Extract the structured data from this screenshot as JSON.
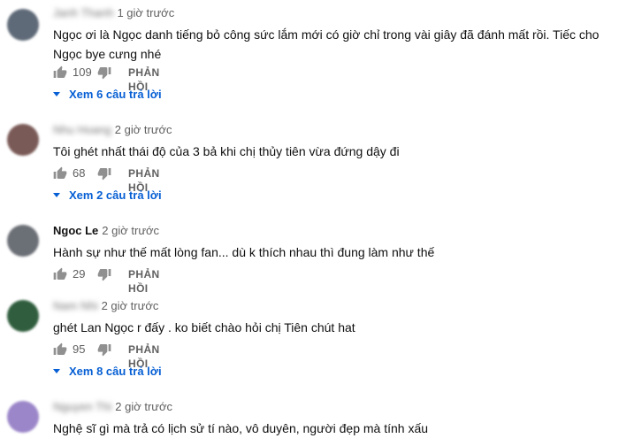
{
  "reply_label": "PHẢN HỒI",
  "comments": [
    {
      "author": "Janh Thanh",
      "author_blurred": true,
      "time": "1 giờ trước",
      "text": "Ngọc ơi là Ngọc danh tiếng bỏ công sức lắm mới có giờ chỉ trong vài giây đã đánh mất rồi.  Tiếc cho Ngọc bye cưng nhé",
      "likes": "109",
      "view_replies": "Xem 6 câu trả lời",
      "avatar_color": "#5f6a78"
    },
    {
      "author": "Nhu Hoang",
      "author_blurred": true,
      "time": "2 giờ trước",
      "text": "Tôi ghét nhất thái độ của 3 bả khi chị thủy tiên vừa đứng dậy đi",
      "likes": "68",
      "view_replies": "Xem 2 câu trả lời",
      "avatar_color": "#7a5a57"
    },
    {
      "author": "Ngoc Le",
      "author_blurred": false,
      "time": "2 giờ trước",
      "text": "Hành sự như thế mất lòng fan... dù k thích nhau thì đung làm như thế",
      "likes": "29",
      "view_replies": "",
      "avatar_color": "#6b6f76"
    },
    {
      "author": "Nam Nhi",
      "author_blurred": true,
      "time": "2 giờ trước",
      "text": "ghét Lan Ngọc r đấy . ko biết chào hỏi chị  Tiên chút hat",
      "likes": "95",
      "view_replies": "Xem 8 câu trả lời",
      "avatar_color": "#2f5d3d"
    },
    {
      "author": "Nguyen Thi",
      "author_blurred": true,
      "time": "2 giờ trước",
      "text": "Nghệ sĩ gì mà trả có lịch sử tí nào, vô duyên, người đẹp mà tính xấu",
      "likes": "",
      "view_replies": "",
      "avatar_color": "#9b86c9"
    }
  ]
}
